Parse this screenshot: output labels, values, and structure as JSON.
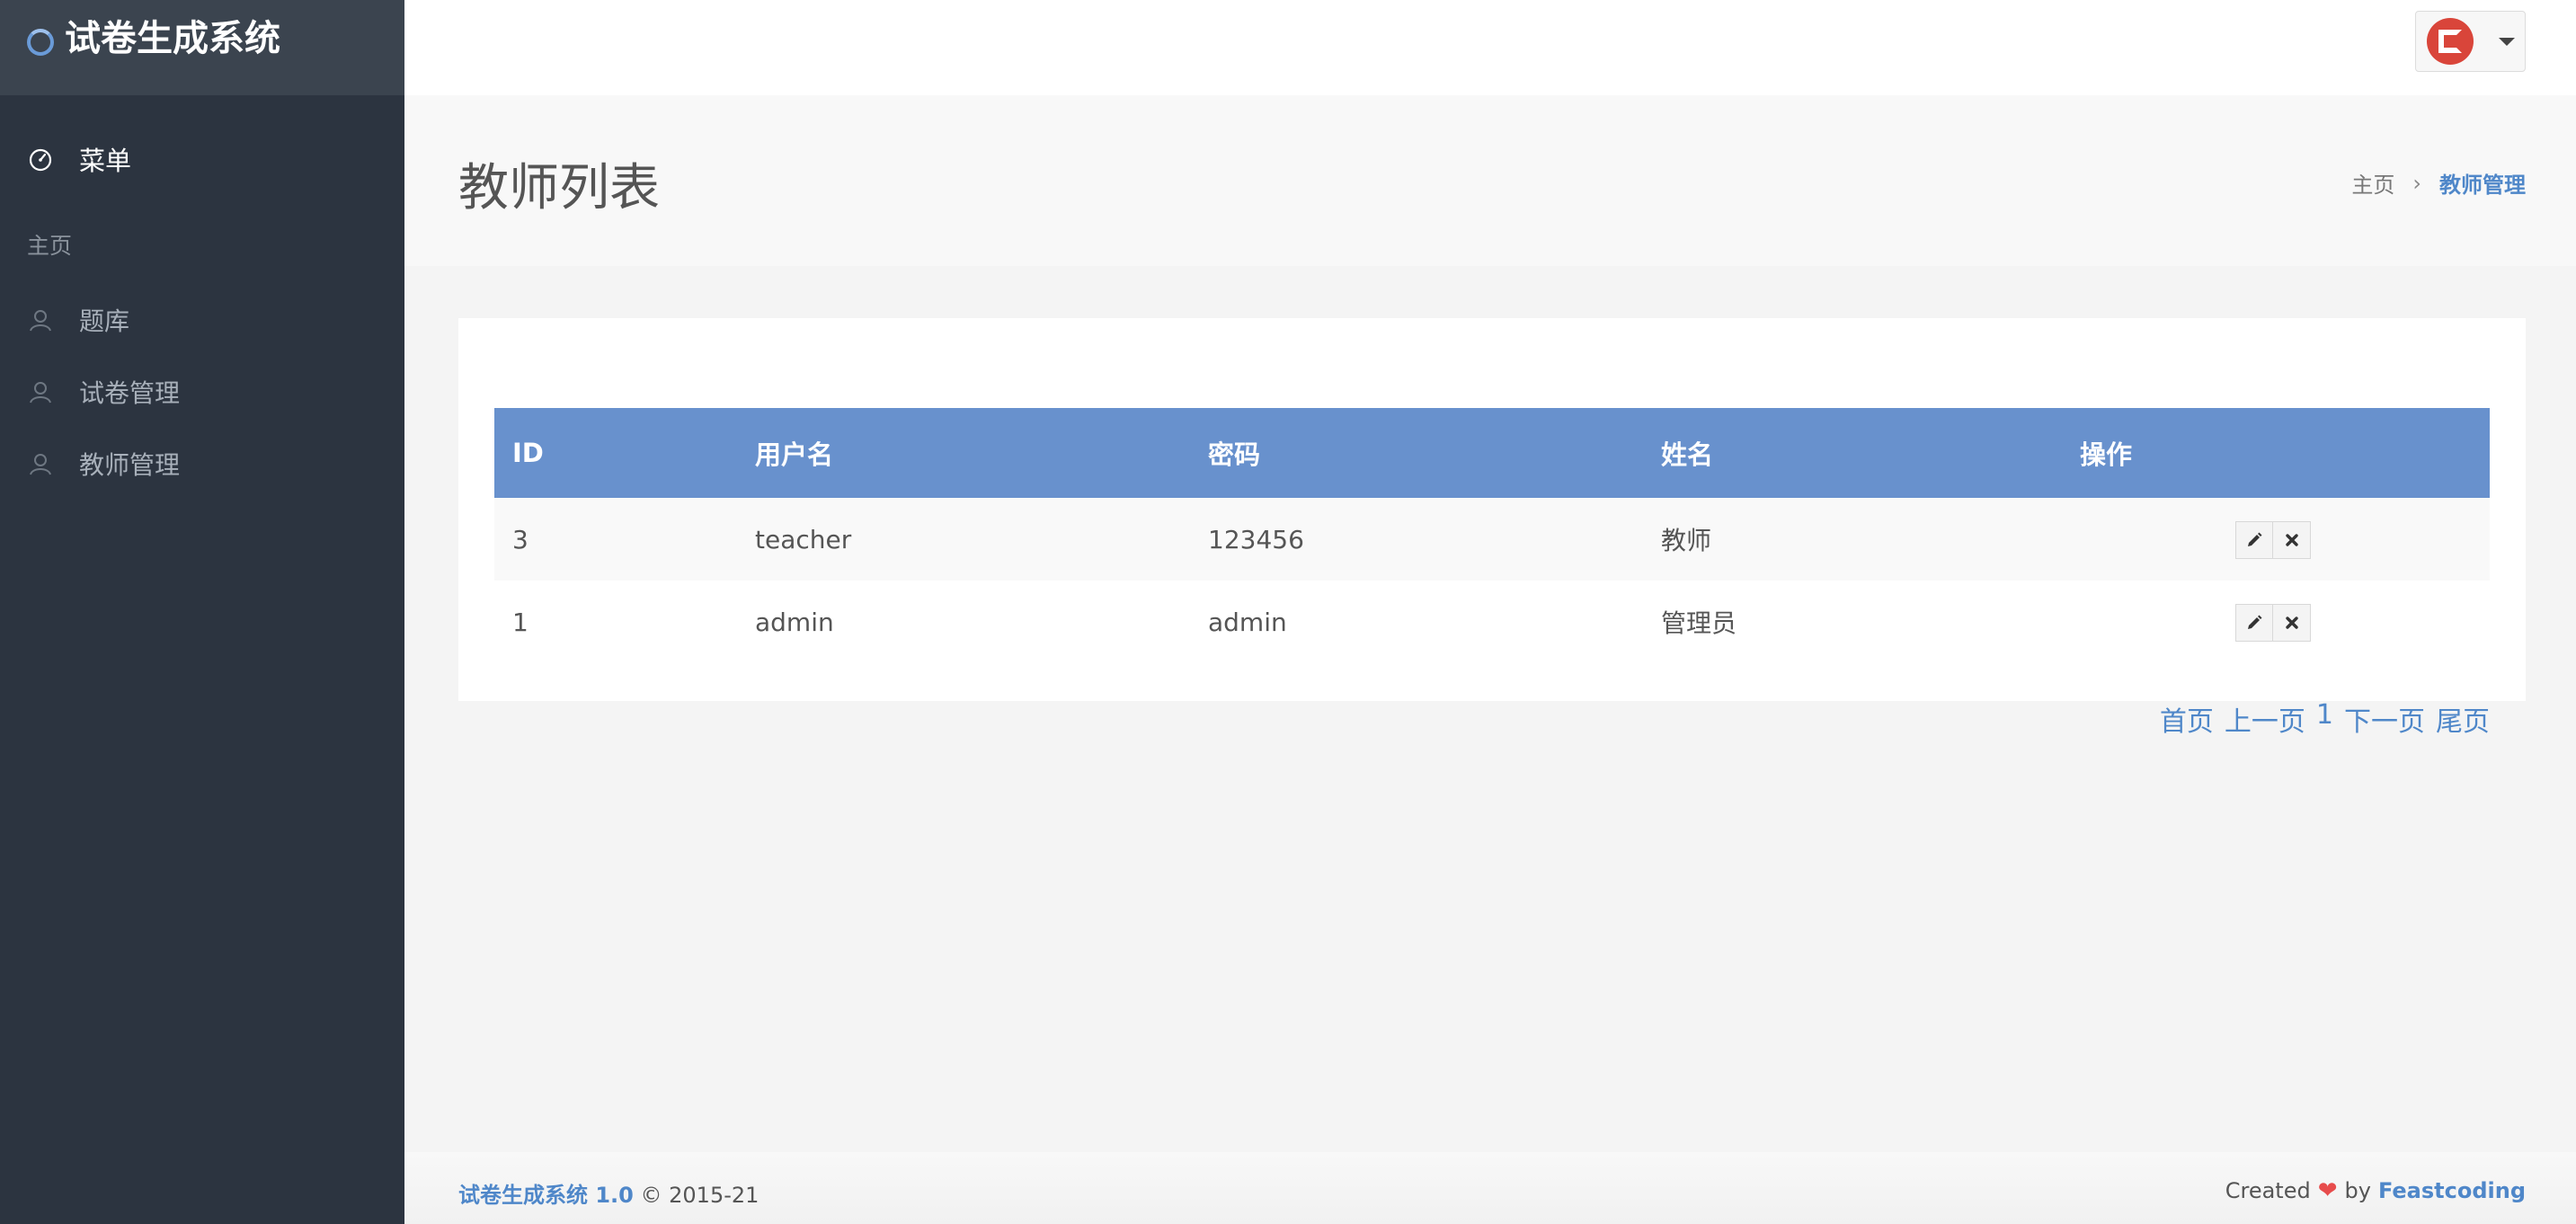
{
  "app": {
    "title": "试卷生成系统"
  },
  "sidebar": {
    "menu_label": "菜单",
    "section_label": "主页",
    "items": [
      {
        "label": "题库",
        "icon": "user-outline-icon"
      },
      {
        "label": "试卷管理",
        "icon": "user-outline-icon"
      },
      {
        "label": "教师管理",
        "icon": "user-outline-icon"
      }
    ]
  },
  "header": {
    "page_title": "教师列表",
    "breadcrumb": {
      "home": "主页",
      "separator": "›",
      "current": "教师管理"
    }
  },
  "table": {
    "columns": [
      "ID",
      "用户名",
      "密码",
      "姓名",
      "操作"
    ],
    "rows": [
      {
        "id": "3",
        "username": "teacher",
        "password": "123456",
        "name": "教师"
      },
      {
        "id": "1",
        "username": "admin",
        "password": "admin",
        "name": "管理员"
      }
    ]
  },
  "pagination": {
    "first": "首页",
    "prev": "上一页",
    "current": "1",
    "next": "下一页",
    "last": "尾页"
  },
  "footer": {
    "app_name": "试卷生成系统 1.0",
    "copyright": "© 2015-21",
    "created": "Created",
    "heart": "❤",
    "by": "by",
    "author": "Feastcoding"
  },
  "colors": {
    "sidebar_bg": "#2c3440",
    "brand_bg": "#3b444f",
    "table_header": "#6891cd",
    "accent": "#4f87c9",
    "heart": "#e74c4c",
    "avatar": "#d9453a"
  }
}
